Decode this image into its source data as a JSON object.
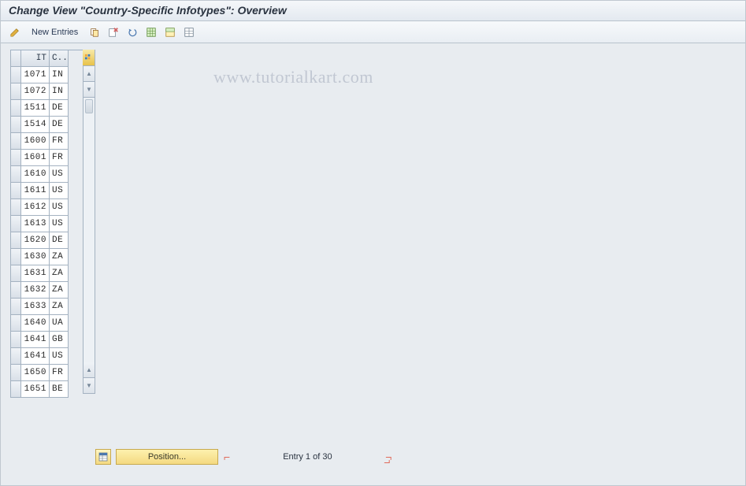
{
  "header": {
    "title": "Change View \"Country-Specific Infotypes\": Overview"
  },
  "toolbar": {
    "new_entries_label": "New Entries"
  },
  "grid": {
    "columns": {
      "it": "IT",
      "country": "C.."
    },
    "rows": [
      {
        "it": "1071",
        "cty": "IN"
      },
      {
        "it": "1072",
        "cty": "IN"
      },
      {
        "it": "1511",
        "cty": "DE"
      },
      {
        "it": "1514",
        "cty": "DE"
      },
      {
        "it": "1600",
        "cty": "FR"
      },
      {
        "it": "1601",
        "cty": "FR"
      },
      {
        "it": "1610",
        "cty": "US"
      },
      {
        "it": "1611",
        "cty": "US"
      },
      {
        "it": "1612",
        "cty": "US"
      },
      {
        "it": "1613",
        "cty": "US"
      },
      {
        "it": "1620",
        "cty": "DE"
      },
      {
        "it": "1630",
        "cty": "ZA"
      },
      {
        "it": "1631",
        "cty": "ZA"
      },
      {
        "it": "1632",
        "cty": "ZA"
      },
      {
        "it": "1633",
        "cty": "ZA"
      },
      {
        "it": "1640",
        "cty": "UA"
      },
      {
        "it": "1641",
        "cty": "GB"
      },
      {
        "it": "1641",
        "cty": "US"
      },
      {
        "it": "1650",
        "cty": "FR"
      },
      {
        "it": "1651",
        "cty": "BE"
      }
    ]
  },
  "footer": {
    "position_label": "Position...",
    "entry_label": "Entry 1 of 30"
  },
  "watermark": "www.tutorialkart.com"
}
